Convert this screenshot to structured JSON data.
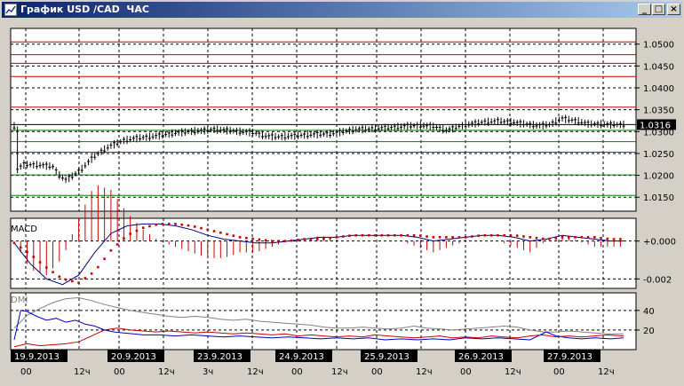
{
  "window": {
    "title": "График USD /CAD  ЧАС",
    "minimize_glyph": "_",
    "maximize_glyph": "□",
    "close_glyph": "×"
  },
  "price_panel": {
    "levels_red": [
      1.0505,
      1.0476,
      1.0456,
      1.0426,
      1.0356
    ],
    "levels_green": [
      1.0303,
      1.0277,
      1.0253,
      1.0201,
      1.0154
    ],
    "current_price": 1.0316,
    "current_price_label": "1.0316",
    "ticks": [
      {
        "value": 1.05,
        "label": "1.0500"
      },
      {
        "value": 1.045,
        "label": "1.0450"
      },
      {
        "value": 1.04,
        "label": "1.0400"
      },
      {
        "value": 1.035,
        "label": "1.0350"
      },
      {
        "value": 1.03,
        "label": "1.0300"
      },
      {
        "value": 1.025,
        "label": "1.0250"
      },
      {
        "value": 1.02,
        "label": "1.0200"
      },
      {
        "value": 1.015,
        "label": "1.0150"
      }
    ],
    "ylim": [
      1.0118,
      1.0536
    ]
  },
  "macd_panel": {
    "label": "MACD",
    "ticks": [
      {
        "value": 0.0,
        "label": "+0.000"
      },
      {
        "value": -0.002,
        "label": "-0.002"
      }
    ],
    "ylim": [
      -0.0025,
      0.0012
    ]
  },
  "dmi_panel": {
    "label": "DMI",
    "ticks": [
      {
        "value": 40,
        "label": "40"
      },
      {
        "value": 20,
        "label": "20"
      }
    ],
    "ylim": [
      0,
      58
    ]
  },
  "dates": [
    "19.9.2013",
    "20.9.2013",
    "23.9.2013",
    "24.9.2013",
    "25.9.2013",
    "26.9.2013",
    "27.9.2013"
  ],
  "hour_labels": [
    "00",
    "12ч",
    "00",
    "12ч",
    "3ч",
    "12ч",
    "00",
    "12ч",
    "00",
    "12ч",
    "00",
    "12ч",
    "00",
    "12ч"
  ],
  "colors": {
    "grid": "#000000",
    "red_level": "#cc0000",
    "green_level": "#008000",
    "macd_line": "#000080",
    "signal": "#cc0000",
    "dmi_gray": "#808080",
    "dmi_blue": "#0000c0",
    "dmi_red": "#cc0000"
  },
  "chart_data": {
    "type": "line",
    "title": "",
    "xlabel": "",
    "ylabel": "",
    "ylim": [
      1.0118,
      1.0536
    ],
    "series": [],
    "close_path": [
      [
        0,
        1.0312
      ],
      [
        1,
        1.0215
      ],
      [
        3,
        1.0225
      ],
      [
        6,
        1.0224
      ],
      [
        9,
        1.0223
      ],
      [
        12,
        1.022
      ],
      [
        14,
        1.02
      ],
      [
        16,
        1.019
      ],
      [
        18,
        1.0198
      ],
      [
        21,
        1.0215
      ],
      [
        24,
        1.0238
      ],
      [
        27,
        1.0255
      ],
      [
        30,
        1.0268
      ],
      [
        34,
        1.028
      ],
      [
        38,
        1.0285
      ],
      [
        42,
        1.0288
      ],
      [
        46,
        1.0292
      ],
      [
        50,
        1.0297
      ],
      [
        54,
        1.03
      ],
      [
        58,
        1.0302
      ],
      [
        62,
        1.0305
      ],
      [
        66,
        1.0303
      ],
      [
        70,
        1.03
      ],
      [
        74,
        1.0298
      ],
      [
        78,
        1.029
      ],
      [
        82,
        1.0288
      ],
      [
        86,
        1.029
      ],
      [
        90,
        1.0292
      ],
      [
        94,
        1.0294
      ],
      [
        98,
        1.0295
      ],
      [
        102,
        1.03
      ],
      [
        106,
        1.0305
      ],
      [
        110,
        1.0306
      ],
      [
        114,
        1.0308
      ],
      [
        118,
        1.031
      ],
      [
        122,
        1.0313
      ],
      [
        126,
        1.0314
      ],
      [
        130,
        1.0312
      ],
      [
        134,
        1.0303
      ],
      [
        138,
        1.0312
      ],
      [
        142,
        1.0318
      ],
      [
        146,
        1.0322
      ],
      [
        150,
        1.0324
      ],
      [
        154,
        1.0322
      ],
      [
        158,
        1.0318
      ],
      [
        162,
        1.0314
      ],
      [
        166,
        1.0316
      ],
      [
        170,
        1.033
      ],
      [
        174,
        1.0325
      ],
      [
        178,
        1.0318
      ],
      [
        182,
        1.0317
      ],
      [
        186,
        1.0316
      ],
      [
        189,
        1.0316
      ]
    ],
    "macd": [
      [
        0,
        -0.0001
      ],
      [
        5,
        -0.0012
      ],
      [
        10,
        -0.002
      ],
      [
        15,
        -0.0023
      ],
      [
        20,
        -0.0018
      ],
      [
        25,
        -0.0006
      ],
      [
        30,
        0.0004
      ],
      [
        35,
        0.0008
      ],
      [
        40,
        0.0009
      ],
      [
        45,
        0.0009
      ],
      [
        50,
        0.0008
      ],
      [
        55,
        0.0006
      ],
      [
        60,
        0.0003
      ],
      [
        65,
        0.0001
      ],
      [
        70,
        0.0
      ],
      [
        75,
        -0.0001
      ],
      [
        80,
        -0.0001
      ],
      [
        85,
        0.0
      ],
      [
        90,
        0.0001
      ],
      [
        95,
        0.0002
      ],
      [
        100,
        0.0002
      ],
      [
        105,
        0.0003
      ],
      [
        110,
        0.0003
      ],
      [
        115,
        0.0003
      ],
      [
        120,
        0.0003
      ],
      [
        125,
        0.0002
      ],
      [
        130,
        0.0
      ],
      [
        135,
        0.0001
      ],
      [
        140,
        0.0002
      ],
      [
        145,
        0.0003
      ],
      [
        150,
        0.0003
      ],
      [
        155,
        0.0002
      ],
      [
        160,
        0.0
      ],
      [
        165,
        0.0001
      ],
      [
        170,
        0.0003
      ],
      [
        175,
        0.0002
      ],
      [
        180,
        0.0001
      ],
      [
        185,
        0.0
      ],
      [
        189,
        0.0
      ]
    ],
    "signal": [
      [
        0,
        -0.0001
      ],
      [
        5,
        -0.0007
      ],
      [
        10,
        -0.0014
      ],
      [
        15,
        -0.002
      ],
      [
        20,
        -0.0022
      ],
      [
        25,
        -0.0016
      ],
      [
        30,
        -0.0005
      ],
      [
        35,
        0.0003
      ],
      [
        40,
        0.0007
      ],
      [
        45,
        0.0009
      ],
      [
        50,
        0.0009
      ],
      [
        55,
        0.0008
      ],
      [
        60,
        0.0006
      ],
      [
        65,
        0.0004
      ],
      [
        70,
        0.0002
      ],
      [
        75,
        0.0001
      ],
      [
        80,
        0.0
      ],
      [
        85,
        0.0
      ],
      [
        90,
        0.0001
      ],
      [
        95,
        0.0001
      ],
      [
        100,
        0.0002
      ],
      [
        105,
        0.0003
      ],
      [
        110,
        0.0003
      ],
      [
        115,
        0.0003
      ],
      [
        120,
        0.0003
      ],
      [
        125,
        0.0003
      ],
      [
        130,
        0.0002
      ],
      [
        135,
        0.0002
      ],
      [
        140,
        0.0002
      ],
      [
        145,
        0.0003
      ],
      [
        150,
        0.0003
      ],
      [
        155,
        0.0003
      ],
      [
        160,
        0.0002
      ],
      [
        165,
        0.0001
      ],
      [
        170,
        0.0002
      ],
      [
        175,
        0.0002
      ],
      [
        180,
        0.0002
      ],
      [
        185,
        0.0001
      ],
      [
        189,
        0.0001
      ]
    ],
    "dmi_gray": [
      [
        0,
        22
      ],
      [
        4,
        35
      ],
      [
        8,
        42
      ],
      [
        12,
        48
      ],
      [
        16,
        52
      ],
      [
        20,
        53
      ],
      [
        24,
        50
      ],
      [
        28,
        46
      ],
      [
        32,
        43
      ],
      [
        36,
        40
      ],
      [
        40,
        38
      ],
      [
        44,
        36
      ],
      [
        48,
        34
      ],
      [
        52,
        33
      ],
      [
        56,
        34
      ],
      [
        60,
        33
      ],
      [
        64,
        31
      ],
      [
        68,
        30
      ],
      [
        72,
        31
      ],
      [
        76,
        29
      ],
      [
        80,
        28
      ],
      [
        84,
        27
      ],
      [
        88,
        26
      ],
      [
        92,
        25
      ],
      [
        96,
        23
      ],
      [
        100,
        22
      ],
      [
        104,
        22
      ],
      [
        108,
        23
      ],
      [
        112,
        22
      ],
      [
        116,
        21
      ],
      [
        120,
        22
      ],
      [
        124,
        24
      ],
      [
        128,
        22
      ],
      [
        132,
        21
      ],
      [
        136,
        20
      ],
      [
        140,
        21
      ],
      [
        144,
        22
      ],
      [
        148,
        23
      ],
      [
        152,
        24
      ],
      [
        156,
        23
      ],
      [
        160,
        20
      ],
      [
        164,
        18
      ],
      [
        168,
        18
      ],
      [
        172,
        19
      ],
      [
        176,
        18
      ],
      [
        180,
        17
      ],
      [
        184,
        16
      ],
      [
        189,
        16
      ]
    ],
    "dmi_blue": [
      [
        0,
        10
      ],
      [
        2,
        40
      ],
      [
        4,
        39
      ],
      [
        7,
        34
      ],
      [
        10,
        30
      ],
      [
        13,
        32
      ],
      [
        16,
        28
      ],
      [
        19,
        30
      ],
      [
        22,
        26
      ],
      [
        25,
        24
      ],
      [
        28,
        20
      ],
      [
        31,
        18
      ],
      [
        34,
        17
      ],
      [
        37,
        16
      ],
      [
        40,
        15
      ],
      [
        45,
        15
      ],
      [
        50,
        14
      ],
      [
        55,
        15
      ],
      [
        60,
        14
      ],
      [
        65,
        13
      ],
      [
        70,
        14
      ],
      [
        75,
        13
      ],
      [
        80,
        12
      ],
      [
        85,
        13
      ],
      [
        90,
        12
      ],
      [
        95,
        11
      ],
      [
        100,
        12
      ],
      [
        105,
        11
      ],
      [
        110,
        12
      ],
      [
        115,
        10
      ],
      [
        120,
        11
      ],
      [
        125,
        10
      ],
      [
        130,
        11
      ],
      [
        135,
        10
      ],
      [
        140,
        12
      ],
      [
        145,
        11
      ],
      [
        150,
        12
      ],
      [
        155,
        11
      ],
      [
        160,
        10
      ],
      [
        165,
        18
      ],
      [
        168,
        14
      ],
      [
        172,
        12
      ],
      [
        176,
        11
      ],
      [
        180,
        12
      ],
      [
        185,
        11
      ],
      [
        189,
        12
      ]
    ],
    "dmi_red": [
      [
        0,
        3
      ],
      [
        4,
        6
      ],
      [
        8,
        4
      ],
      [
        12,
        5
      ],
      [
        16,
        6
      ],
      [
        20,
        8
      ],
      [
        24,
        14
      ],
      [
        28,
        20
      ],
      [
        32,
        22
      ],
      [
        36,
        20
      ],
      [
        40,
        19
      ],
      [
        44,
        18
      ],
      [
        48,
        19
      ],
      [
        52,
        18
      ],
      [
        56,
        17
      ],
      [
        60,
        18
      ],
      [
        64,
        17
      ],
      [
        68,
        16
      ],
      [
        72,
        17
      ],
      [
        76,
        16
      ],
      [
        80,
        15
      ],
      [
        84,
        16
      ],
      [
        88,
        14
      ],
      [
        92,
        15
      ],
      [
        96,
        14
      ],
      [
        100,
        13
      ],
      [
        104,
        14
      ],
      [
        108,
        13
      ],
      [
        112,
        15
      ],
      [
        116,
        14
      ],
      [
        120,
        13
      ],
      [
        124,
        12
      ],
      [
        128,
        13
      ],
      [
        132,
        14
      ],
      [
        136,
        12
      ],
      [
        140,
        13
      ],
      [
        144,
        12
      ],
      [
        148,
        14
      ],
      [
        152,
        13
      ],
      [
        156,
        12
      ],
      [
        160,
        14
      ],
      [
        164,
        15
      ],
      [
        168,
        13
      ],
      [
        172,
        14
      ],
      [
        176,
        13
      ],
      [
        180,
        14
      ],
      [
        184,
        15
      ],
      [
        189,
        14
      ]
    ]
  }
}
